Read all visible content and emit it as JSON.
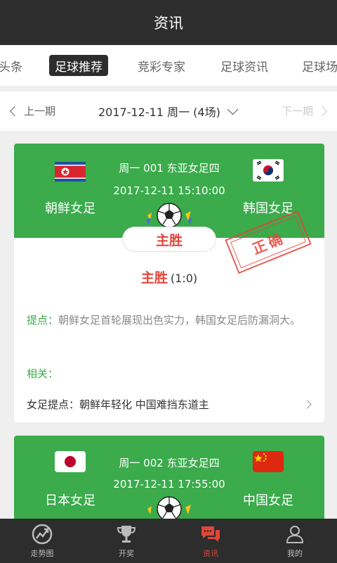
{
  "header": {
    "title": "资讯"
  },
  "tabs": [
    {
      "label": "头条"
    },
    {
      "label": "足球推荐"
    },
    {
      "label": "竞彩专家"
    },
    {
      "label": "足球资讯"
    },
    {
      "label": "足球场"
    }
  ],
  "datebar": {
    "prev_label": "上一期",
    "date_label": "2017-12-11 周一 (4场)",
    "next_label": "下一期"
  },
  "matches": [
    {
      "info": "周一 001 东亚女足四",
      "time": "2017-12-11 15:10:00",
      "home": "朝鲜女足",
      "away": "韩国女足",
      "pick": "主胜",
      "stamp": "正确",
      "result_label": "主胜",
      "result_score": "(1:0)",
      "tip_label": "提点：",
      "tip_text": "朝鲜女足首轮展现出色实力，韩国女足后防漏洞大。",
      "related_label": "相关：",
      "related_item": "女足提点：朝鲜年轻化 中国难挡东道主"
    },
    {
      "info": "周一 002 东亚女足四",
      "time": "2017-12-11 17:55:00",
      "home": "日本女足",
      "away": "中国女足"
    }
  ],
  "bottom_nav": [
    {
      "label": "走势图"
    },
    {
      "label": "开奖"
    },
    {
      "label": "资讯"
    },
    {
      "label": "我的"
    }
  ],
  "colors": {
    "green": "#3bab4c",
    "red": "#e2463a",
    "dark": "#2d2d2d"
  }
}
